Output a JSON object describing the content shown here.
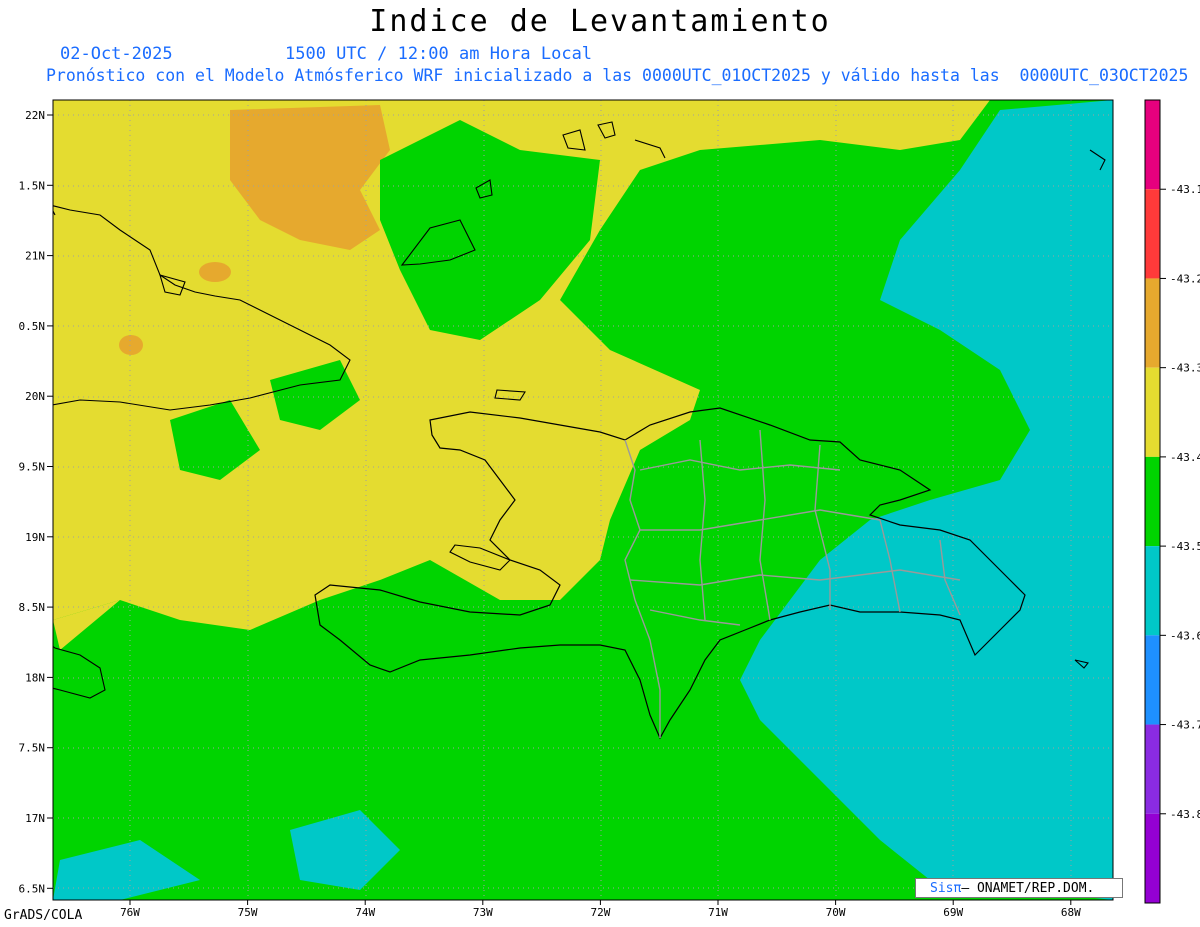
{
  "title": "Indice de Levantamiento",
  "date_line": "02-Oct-2025",
  "time_line": "1500 UTC / 12:00 am Hora Local",
  "forecast_line": "Pronóstico con el Modelo Atmósferico WRF inicializado a las 0000UTC_01OCT2025 y válido hasta las  0000UTC_03OCT2025",
  "lat_labels": [
    "22N",
    "1.5N",
    "21N",
    "0.5N",
    "20N",
    "9.5N",
    "19N",
    "8.5N",
    "18N",
    "7.5N",
    "17N",
    "6.5N"
  ],
  "lon_labels": [
    "76W",
    "75W",
    "74W",
    "73W",
    "72W",
    "71W",
    "70W",
    "69W",
    "68W"
  ],
  "colorbar": {
    "labels": [
      "-43.1",
      "-43.2",
      "-43.3",
      "-43.4",
      "-43.5",
      "-43.6",
      "-43.7",
      "-43.8"
    ],
    "colors": [
      "#e6007e",
      "#ff3a3a",
      "#e6a92e",
      "#e4dc30",
      "#00d400",
      "#00c8c8",
      "#1e90ff",
      "#8a2be2",
      "#9400d3"
    ]
  },
  "logo": {
    "sis": "Sisπ",
    "org": "– ONAMET/REP.DOM."
  },
  "footer": "GrADS/COLA"
}
